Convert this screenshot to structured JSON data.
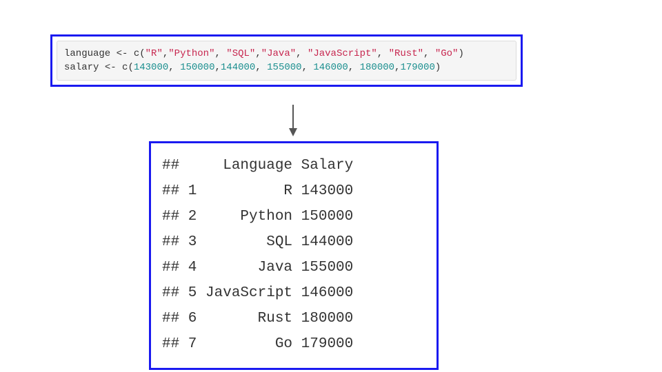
{
  "code": {
    "line1": {
      "lhs": "language",
      "assign": " <- ",
      "fn": "c",
      "lp": "(",
      "s1": "\"R\"",
      "c1": ",",
      "s2": "\"Python\"",
      "c2": ", ",
      "s3": "\"SQL\"",
      "c3": ",",
      "s4": "\"Java\"",
      "c4": ", ",
      "s5": "\"JavaScript\"",
      "c5": ", ",
      "s6": "\"Rust\"",
      "c6": ", ",
      "s7": "\"Go\"",
      "rp": ")"
    },
    "line2": {
      "lhs": "salary",
      "assign": " <- ",
      "fn": "c",
      "lp": "(",
      "n1": "143000",
      "c1": ", ",
      "n2": "150000",
      "c2": ",",
      "n3": "144000",
      "c3": ", ",
      "n4": "155000",
      "c4": ", ",
      "n5": "146000",
      "c5": ", ",
      "n6": "180000",
      "c6": ",",
      "n7": "179000",
      "rp": ")"
    }
  },
  "output": {
    "header": "##     Language Salary",
    "rows": [
      "## 1          R 143000",
      "## 2     Python 150000",
      "## 3        SQL 144000",
      "## 4       Java 155000",
      "## 5 JavaScript 146000",
      "## 6       Rust 180000",
      "## 7         Go 179000"
    ]
  }
}
